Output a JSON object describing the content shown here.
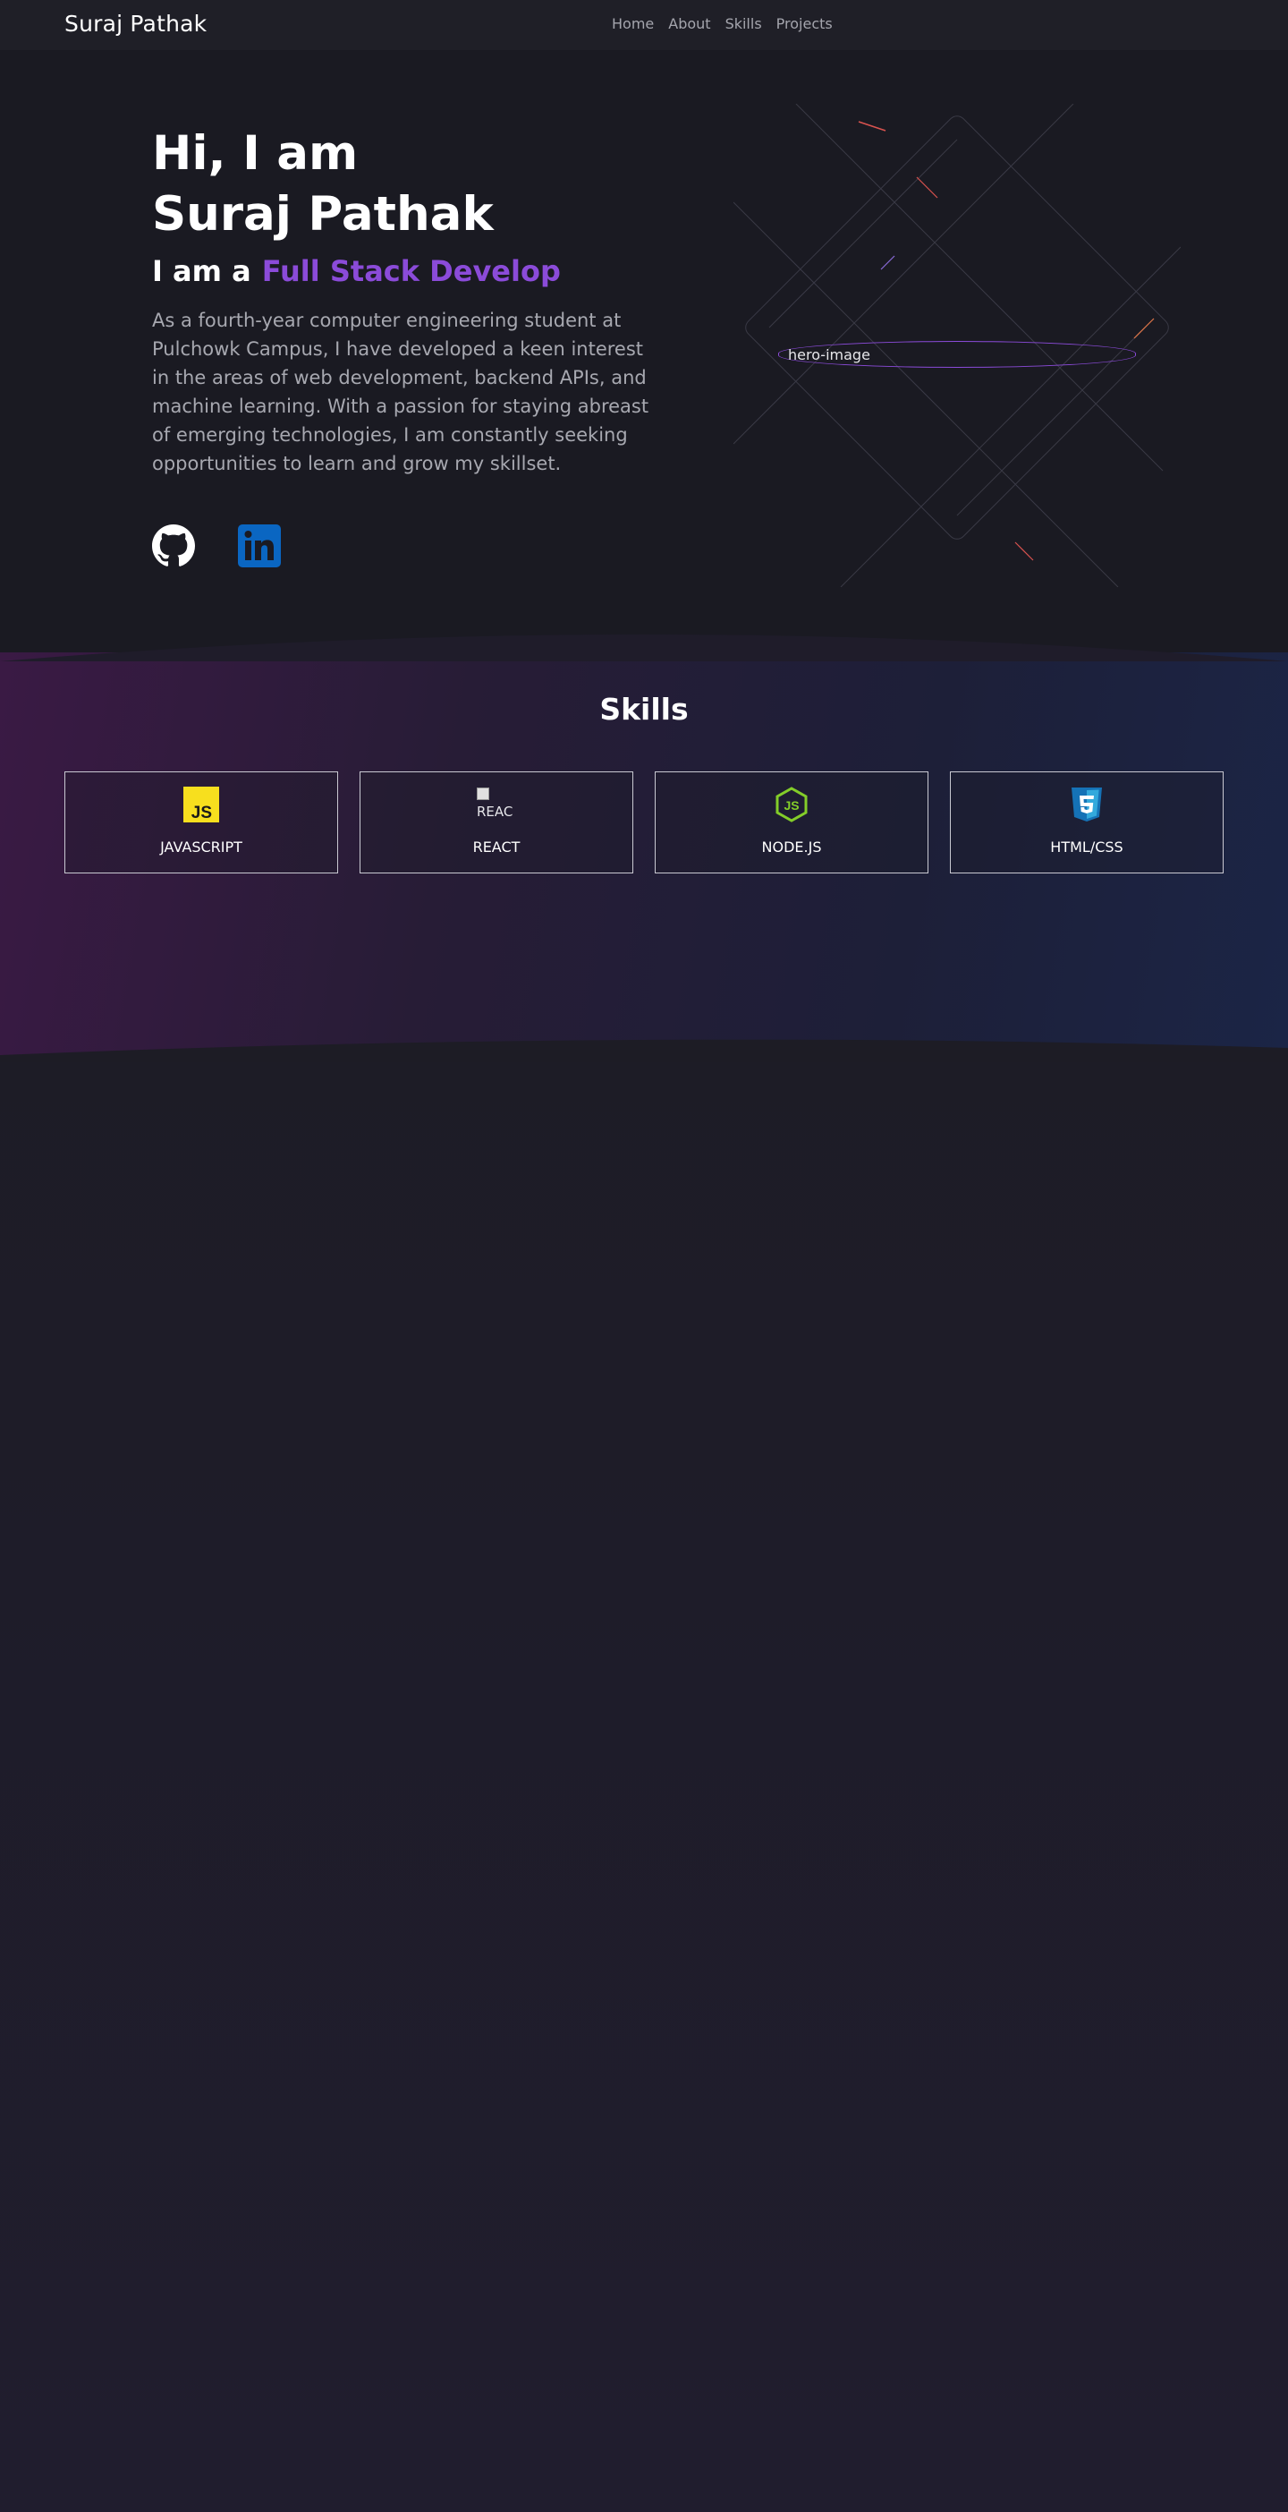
{
  "nav": {
    "brand": "Suraj Pathak",
    "links": [
      "Home",
      "About",
      "Skills",
      "Projects"
    ]
  },
  "hero": {
    "greeting": "Hi, I am",
    "name": "Suraj Pathak",
    "role_prefix": "I am a",
    "role_typed": "Full Stack Develop",
    "description": "As a fourth-year computer engineering student at Pulchowk Campus, I have developed a keen interest in the areas of web development, backend APIs, and machine learning. With a passion for staying abreast of emerging technologies, I am constantly seeking opportunities to learn and grow my skillset.",
    "image_alt": "hero-image",
    "socials": [
      {
        "icon": "github-icon"
      },
      {
        "icon": "linkedin-icon"
      }
    ]
  },
  "skills": {
    "title": "Skills",
    "items": [
      {
        "label": "JAVASCRIPT",
        "icon": "javascript-icon"
      },
      {
        "label": "REACT",
        "icon": "react-icon",
        "alt": "REAC"
      },
      {
        "label": "NODE.JS",
        "icon": "nodejs-icon"
      },
      {
        "label": "HTML/CSS",
        "icon": "css3-icon"
      }
    ]
  },
  "colors": {
    "accent": "#8b4bd9",
    "background": "#1a1a22",
    "navbar": "#1f1f27",
    "linkedin": "#0a66c2",
    "javascript": "#f7df1e",
    "nodejs": "#83cd29",
    "css3": "#1572b6"
  }
}
